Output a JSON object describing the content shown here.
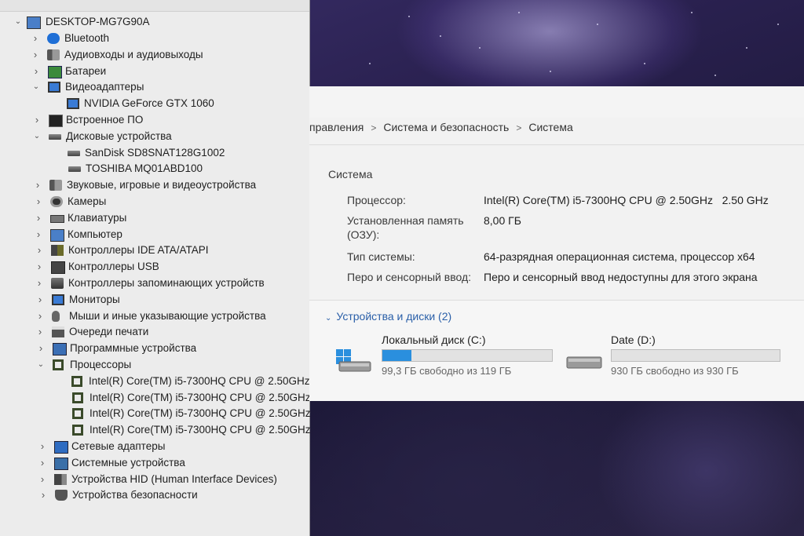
{
  "device_manager": {
    "root": "DESKTOP-MG7G90A",
    "nodes": [
      {
        "label": "Bluetooth",
        "expanded": false,
        "icon": "bluetooth-icon"
      },
      {
        "label": "Аудиовходы и аудиовыходы",
        "expanded": false,
        "icon": "speaker-icon"
      },
      {
        "label": "Батареи",
        "expanded": false,
        "icon": "battery-icon"
      },
      {
        "label": "Видеоадаптеры",
        "expanded": true,
        "icon": "display-adapter-icon"
      },
      {
        "label": "NVIDIA GeForce GTX 1060",
        "child": true,
        "icon": "display-adapter-icon"
      },
      {
        "label": "Встроенное ПО",
        "expanded": false,
        "icon": "firmware-icon"
      },
      {
        "label": "Дисковые устройства",
        "expanded": true,
        "icon": "disk-drive-icon"
      },
      {
        "label": "SanDisk SD8SNAT128G1002",
        "child": true,
        "icon": "disk-drive-icon"
      },
      {
        "label": "TOSHIBA MQ01ABD100",
        "child": true,
        "icon": "disk-drive-icon"
      },
      {
        "label": "Звуковые, игровые и видеоустройства",
        "expanded": false,
        "icon": "speaker-icon"
      },
      {
        "label": "Камеры",
        "expanded": false,
        "icon": "camera-icon"
      },
      {
        "label": "Клавиатуры",
        "expanded": false,
        "icon": "keyboard-icon"
      },
      {
        "label": "Компьютер",
        "expanded": false,
        "icon": "computer-icon"
      },
      {
        "label": "Контроллеры IDE ATA/ATAPI",
        "expanded": false,
        "icon": "ide-controller-icon"
      },
      {
        "label": "Контроллеры USB",
        "expanded": false,
        "icon": "usb-icon"
      },
      {
        "label": "Контроллеры запоминающих устройств",
        "expanded": false,
        "icon": "storage-controller-icon"
      },
      {
        "label": "Мониторы",
        "expanded": false,
        "icon": "monitor-icon"
      },
      {
        "label": "Мыши и иные указывающие устройства",
        "expanded": false,
        "icon": "mouse-icon"
      },
      {
        "label": "Очереди печати",
        "expanded": false,
        "icon": "printer-icon"
      },
      {
        "label": "Программные устройства",
        "expanded": false,
        "icon": "software-device-icon"
      },
      {
        "label": "Процессоры",
        "expanded": true,
        "icon": "processor-icon"
      },
      {
        "label": "Intel(R) Core(TM) i5-7300HQ CPU @ 2.50GHz",
        "child": true,
        "icon": "processor-icon"
      },
      {
        "label": "Intel(R) Core(TM) i5-7300HQ CPU @ 2.50GHz",
        "child": true,
        "icon": "processor-icon"
      },
      {
        "label": "Intel(R) Core(TM) i5-7300HQ CPU @ 2.50GHz",
        "child": true,
        "icon": "processor-icon"
      },
      {
        "label": "Intel(R) Core(TM) i5-7300HQ CPU @ 2.50GHz",
        "child": true,
        "icon": "processor-icon"
      },
      {
        "label": "Сетевые адаптеры",
        "expanded": false,
        "icon": "network-adapter-icon"
      },
      {
        "label": "Системные устройства",
        "expanded": false,
        "icon": "system-device-icon"
      },
      {
        "label": "Устройства HID (Human Interface Devices)",
        "expanded": false,
        "icon": "hid-icon"
      },
      {
        "label": "Устройства безопасности",
        "expanded": false,
        "icon": "security-device-icon"
      }
    ]
  },
  "system_panel": {
    "breadcrumb": [
      "правления",
      "Система и безопасность",
      "Система"
    ],
    "breadcrumb_separator": ">",
    "group_title": "Система",
    "properties": [
      {
        "label": "Процессор:",
        "value": "Intel(R) Core(TM) i5-7300HQ CPU @ 2.50GHz   2.50 GHz"
      },
      {
        "label": "Установленная память (ОЗУ):",
        "value": "8,00 ГБ"
      },
      {
        "label": "Тип системы:",
        "value": "64-разрядная операционная система, процессор x64"
      },
      {
        "label": "Перо и сенсорный ввод:",
        "value": "Перо и сенсорный ввод недоступны для этого экрана"
      }
    ],
    "devices_title": "Устройства и диски (2)",
    "disks": [
      {
        "name": "Локальный диск (C:)",
        "free_text": "99,3 ГБ свободно из 119 ГБ",
        "used_fraction": 0.17,
        "icon": "windows-drive-icon"
      },
      {
        "name": "Date (D:)",
        "free_text": "930 ГБ свободно из 930 ГБ",
        "used_fraction": 0.0,
        "icon": "drive-icon"
      }
    ]
  },
  "colors": {
    "accent": "#2a8fde",
    "link": "#2a5fa8"
  }
}
